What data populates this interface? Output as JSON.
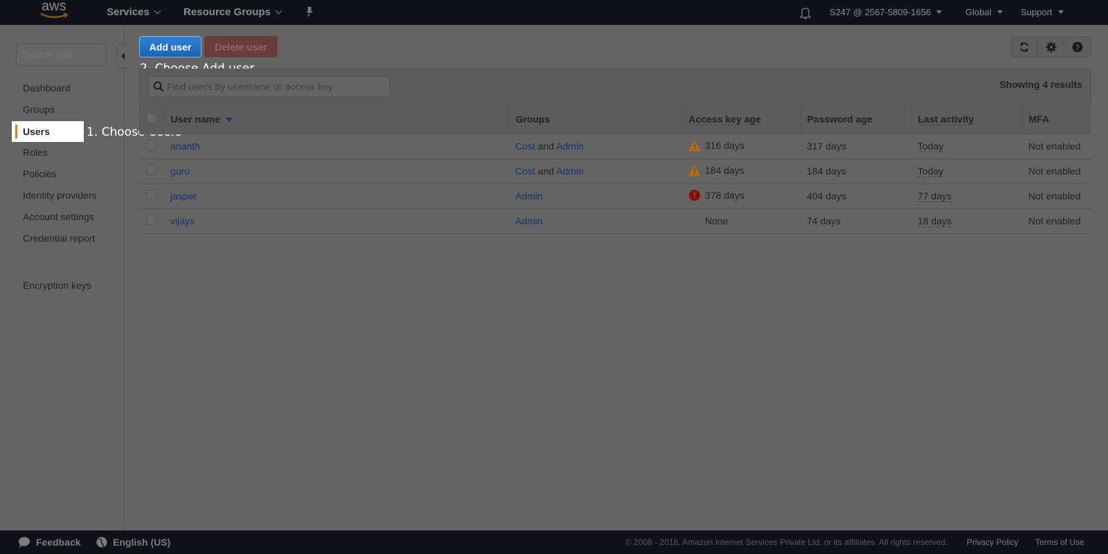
{
  "topnav": {
    "logo": "aws",
    "services": "Services",
    "resource_groups": "Resource Groups",
    "account": "S247 @ 2567-5809-1656",
    "region": "Global",
    "support": "Support"
  },
  "sidebar": {
    "search_placeholder": "Search IAM",
    "items": [
      {
        "label": "Dashboard"
      },
      {
        "label": "Groups"
      },
      {
        "label": "Users",
        "active": true
      },
      {
        "label": "Roles"
      },
      {
        "label": "Policies"
      },
      {
        "label": "Identity providers"
      },
      {
        "label": "Account settings"
      },
      {
        "label": "Credential report"
      }
    ],
    "extra_items": [
      {
        "label": "Encryption keys"
      }
    ]
  },
  "callouts": {
    "step1": "1. Choose Users",
    "step2": "2. Choose Add user"
  },
  "toolbar": {
    "add_user": "Add user",
    "delete_user": "Delete user",
    "icons": [
      "refresh-icon",
      "gear-icon",
      "help-icon"
    ]
  },
  "table": {
    "search_placeholder": "Find users by username or access key",
    "showing": "Showing 4 results",
    "columns": [
      "User name",
      "Groups",
      "Access key age",
      "Password age",
      "Last activity",
      "MFA"
    ],
    "rows": [
      {
        "user": "ananth",
        "groups": [
          "Cost",
          "Admin"
        ],
        "group_joiner": "and",
        "key_status": "warning",
        "key_age": "316 days",
        "password_age": "317 days",
        "last_activity": "Today",
        "mfa": "Not enabled"
      },
      {
        "user": "guru",
        "groups": [
          "Cost",
          "Admin"
        ],
        "group_joiner": "and",
        "key_status": "warning",
        "key_age": "184 days",
        "password_age": "184 days",
        "last_activity": "Today",
        "mfa": "Not enabled"
      },
      {
        "user": "jasper",
        "groups": [
          "Admin"
        ],
        "group_joiner": "",
        "key_status": "error",
        "key_age": "378 days",
        "password_age": "404 days",
        "last_activity": "77 days",
        "mfa": "Not enabled"
      },
      {
        "user": "vijays",
        "groups": [
          "Admin"
        ],
        "group_joiner": "",
        "key_status": "none",
        "key_age": "None",
        "password_age": "74 days",
        "last_activity": "18 days",
        "mfa": "Not enabled"
      }
    ]
  },
  "footer": {
    "feedback": "Feedback",
    "language": "English (US)",
    "copyright": "© 2008 - 2018, Amazon Internet Services Private Ltd. or its affiliates. All rights reserved.",
    "privacy": "Privacy Policy",
    "terms": "Terms of Use"
  },
  "colors": {
    "accent_blue": "#1a64b8",
    "active_bar": "#e07a12",
    "warning": "#b86a12",
    "error": "#8a0a0a",
    "link": "#13366b"
  }
}
